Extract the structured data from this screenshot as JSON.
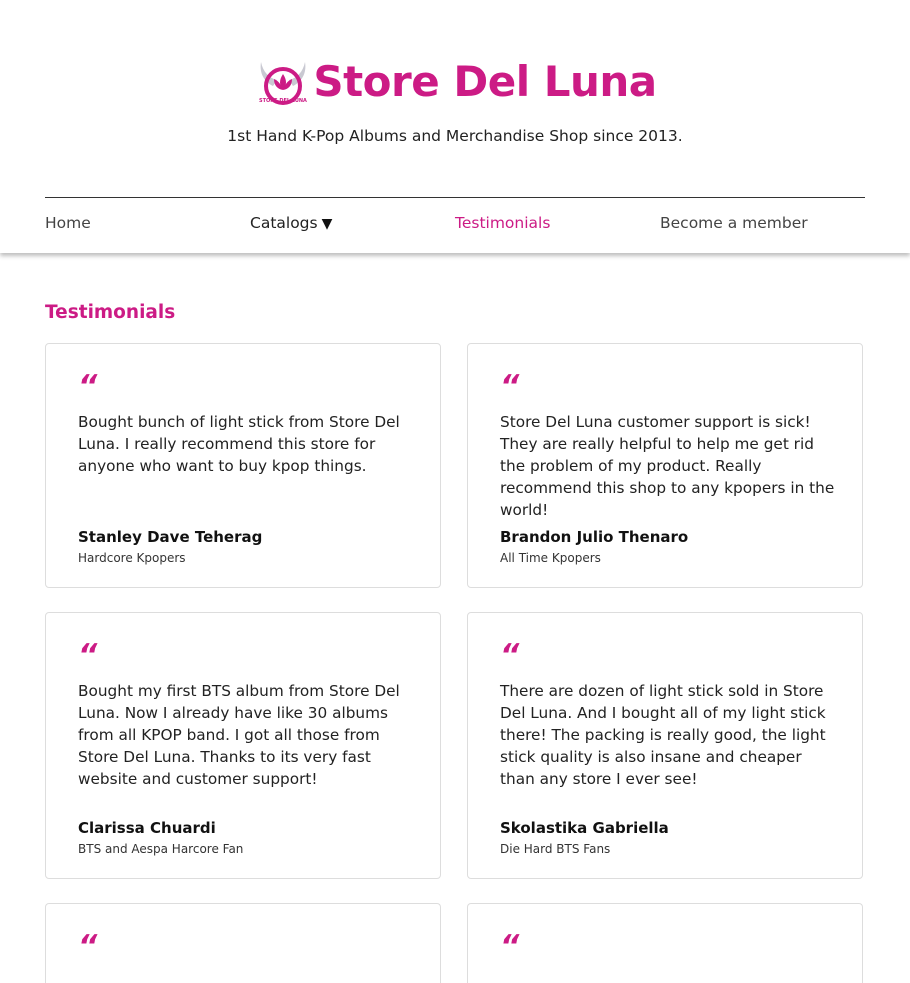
{
  "brand": {
    "title": "Store Del Luna",
    "tagline": "1st Hand K-Pop Albums and Merchandise Shop since 2013.",
    "logo_icon": "lotus-logo-icon",
    "logo_text": "STORE DEL LUNA",
    "accent_color": "#cc1b85"
  },
  "nav": {
    "home": "Home",
    "catalogs": "Catalogs",
    "catalogs_caret": "▼",
    "testimonials": "Testimonials",
    "member": "Become a member",
    "active": "Testimonials"
  },
  "section": {
    "title": "Testimonials"
  },
  "testimonials": [
    {
      "quote_mark": "“",
      "text": "Bought bunch of light stick from Store Del Luna. I really recommend this store for anyone who want to buy kpop things.",
      "author": "Stanley Dave Teherag",
      "role": "Hardcore Kpopers"
    },
    {
      "quote_mark": "“",
      "text": "Store Del Luna customer support is sick! They are really helpful to help me get rid the problem of my product. Really recommend this shop to any kpopers in the world!",
      "author": "Brandon Julio Thenaro",
      "role": "All Time Kpopers"
    },
    {
      "quote_mark": "“",
      "text": "Bought my first BTS album from Store Del Luna. Now I already have like 30 albums from all KPOP band. I got all those from Store Del Luna. Thanks to its very fast website and customer support!",
      "author": "Clarissa Chuardi",
      "role": "BTS and Aespa Harcore Fan"
    },
    {
      "quote_mark": "“",
      "text": "There are dozen of light stick sold in Store Del Luna. And I bought all of my light stick there! The packing is really good, the light stick quality is also insane and cheaper than any store I ever see!",
      "author": "Skolastika Gabriella",
      "role": "Die Hard BTS Fans"
    },
    {
      "quote_mark": "“"
    },
    {
      "quote_mark": "“"
    }
  ]
}
